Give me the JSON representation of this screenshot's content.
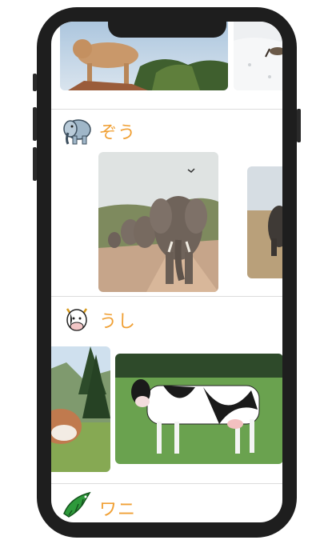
{
  "sections": [
    {
      "label": "ぞう",
      "icon": "elephant-icon"
    },
    {
      "label": "うし",
      "icon": "cow-icon"
    },
    {
      "label": "ワニ",
      "icon": "crocodile-icon"
    }
  ],
  "colors": {
    "label": "#f0a035",
    "frame": "#1e1e1e",
    "divider": "#dcdcdc"
  }
}
